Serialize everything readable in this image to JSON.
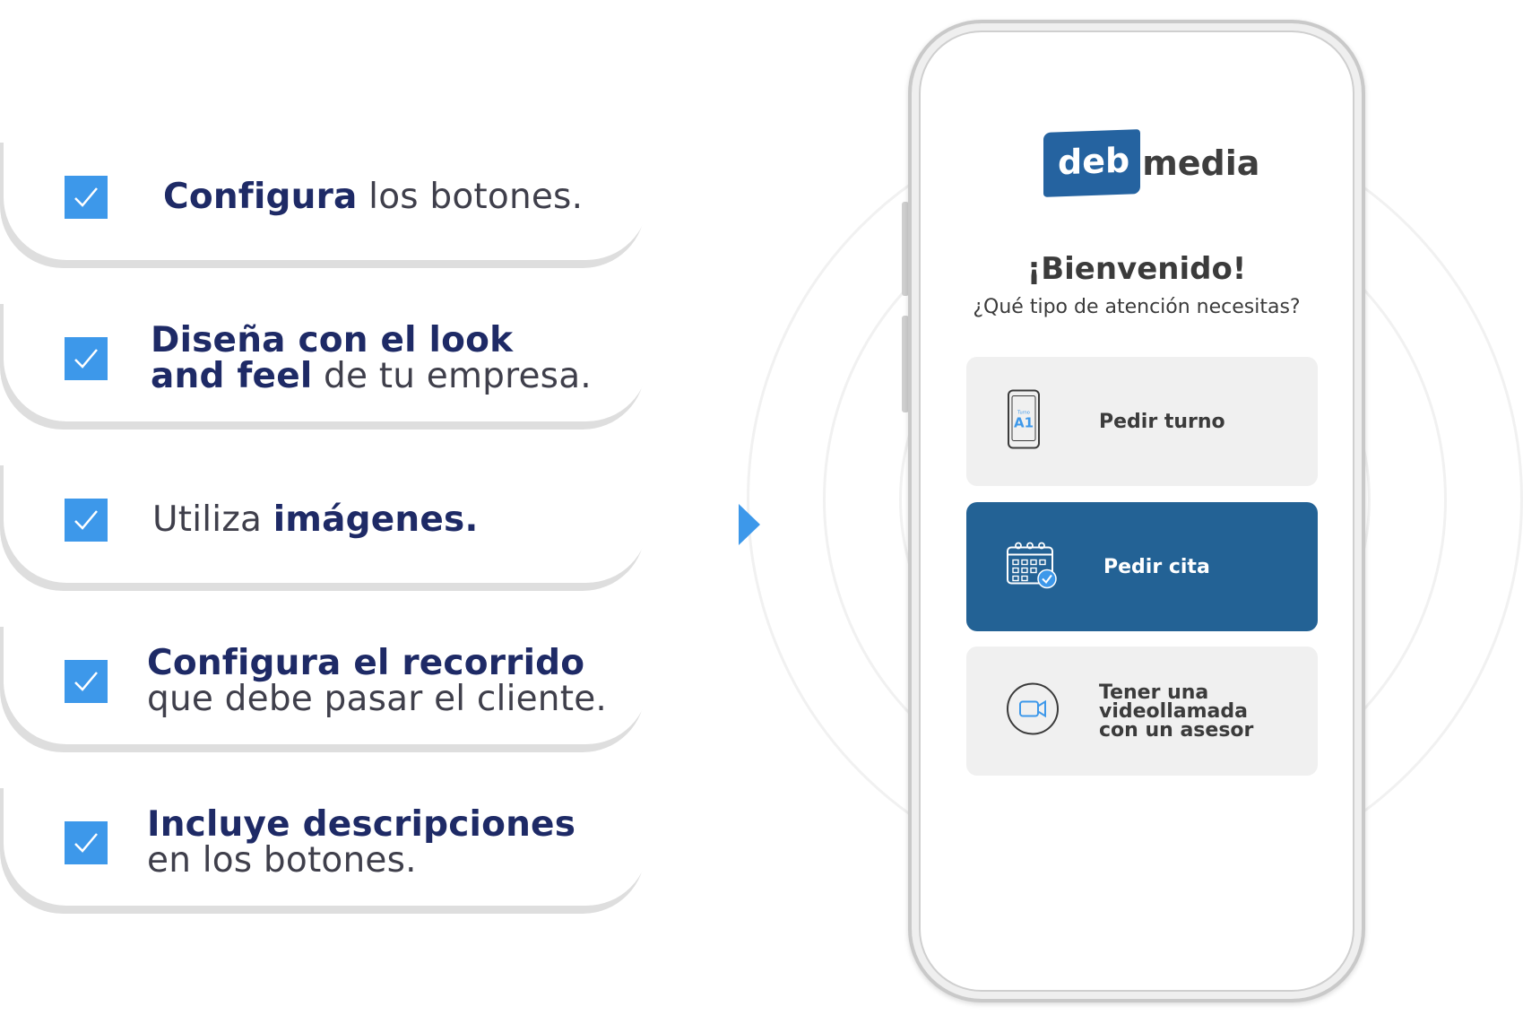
{
  "features": [
    {
      "bold": "Configura",
      "regular": " los botones.",
      "line2_bold": "",
      "line2_regular": ""
    },
    {
      "bold": "Diseña con el look",
      "regular": "",
      "line2_bold": "and feel",
      "line2_regular": " de tu empresa."
    },
    {
      "bold": "",
      "regular": "Utiliza ",
      "bold_after": "imágenes.",
      "line2_bold": "",
      "line2_regular": ""
    },
    {
      "bold": "Configura el recorrido",
      "regular": "",
      "line2_bold": "",
      "line2_regular": "que debe pasar el cliente."
    },
    {
      "bold": "Incluye descripciones",
      "regular": "",
      "line2_bold": "",
      "line2_regular": "en los botones."
    }
  ],
  "phone": {
    "logo_left": "deb",
    "logo_right": "media",
    "title": "¡Bienvenido!",
    "subtitle": "¿Qué tipo de atención necesitas?",
    "options": [
      {
        "label": "Pedir turno",
        "icon": "phone-ticket-icon",
        "icon_text_small": "Turno",
        "icon_text": "A1"
      },
      {
        "label": "Pedir cita",
        "icon": "calendar-check-icon"
      },
      {
        "label": "Tener una videollamada con un asesor",
        "line1": "Tener una",
        "line2": "videollamada",
        "line3": "con un asesor",
        "icon": "video-camera-icon"
      }
    ]
  },
  "colors": {
    "accent": "#3d98ea",
    "brand": "#236295",
    "heading": "#1e2a66"
  }
}
